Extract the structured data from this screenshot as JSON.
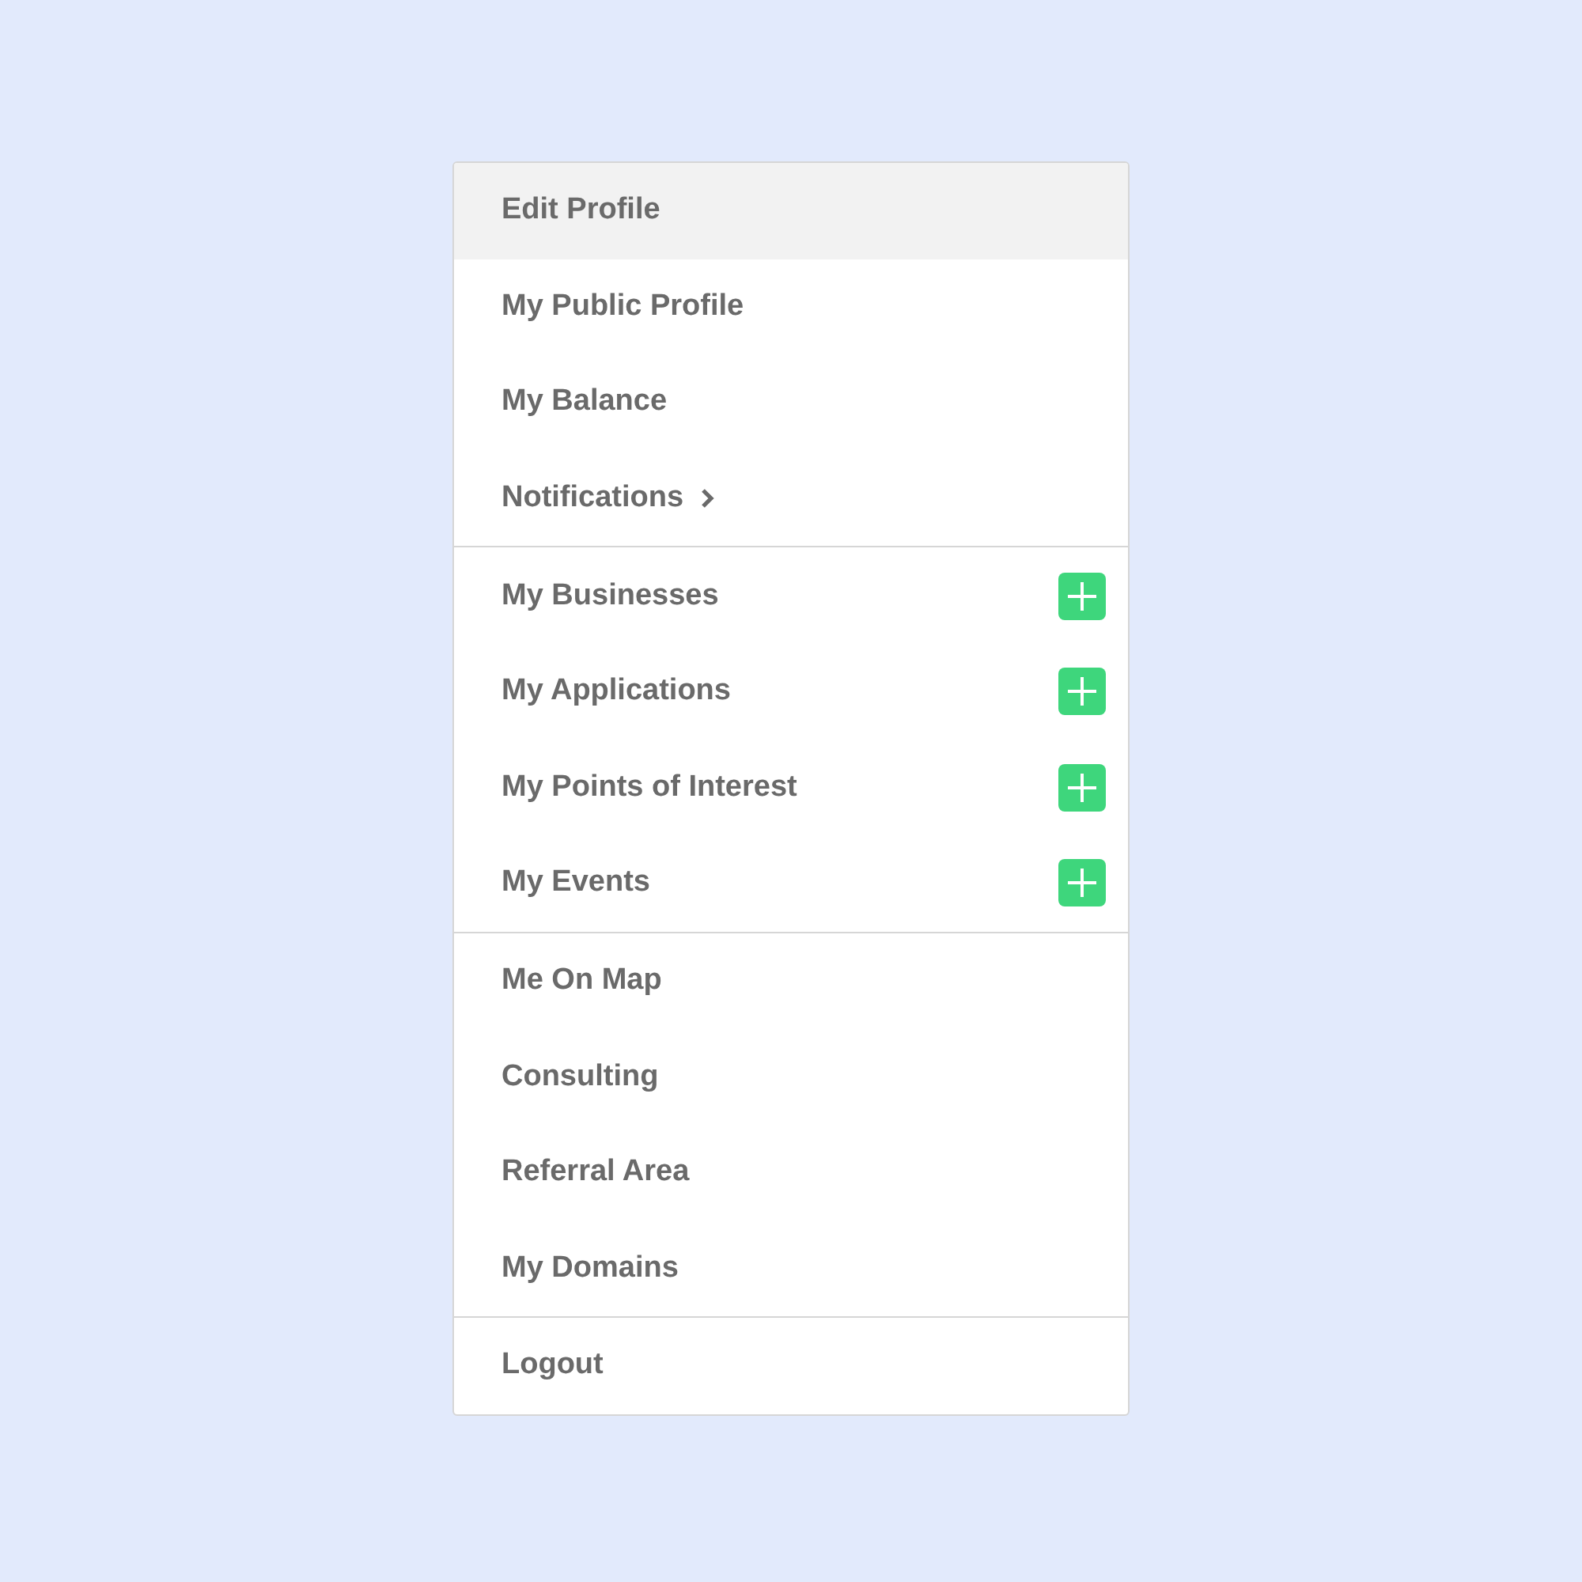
{
  "menu": {
    "sections": [
      {
        "items": [
          {
            "label": "Edit Profile",
            "kind": "plain",
            "selected": true
          },
          {
            "label": "My Public Profile",
            "kind": "plain",
            "selected": false
          },
          {
            "label": "My Balance",
            "kind": "plain",
            "selected": false
          },
          {
            "label": "Notifications",
            "kind": "submenu",
            "selected": false
          }
        ]
      },
      {
        "items": [
          {
            "label": "My Businesses",
            "kind": "add",
            "selected": false
          },
          {
            "label": "My Applications",
            "kind": "add",
            "selected": false
          },
          {
            "label": "My Points of Interest",
            "kind": "add",
            "selected": false
          },
          {
            "label": "My Events",
            "kind": "add",
            "selected": false
          }
        ]
      },
      {
        "items": [
          {
            "label": "Me On Map",
            "kind": "plain",
            "selected": false
          },
          {
            "label": "Consulting",
            "kind": "plain",
            "selected": false
          },
          {
            "label": "Referral Area",
            "kind": "plain",
            "selected": false
          },
          {
            "label": "My Domains",
            "kind": "plain",
            "selected": false
          }
        ]
      },
      {
        "items": [
          {
            "label": "Logout",
            "kind": "plain",
            "selected": false
          }
        ]
      }
    ]
  }
}
